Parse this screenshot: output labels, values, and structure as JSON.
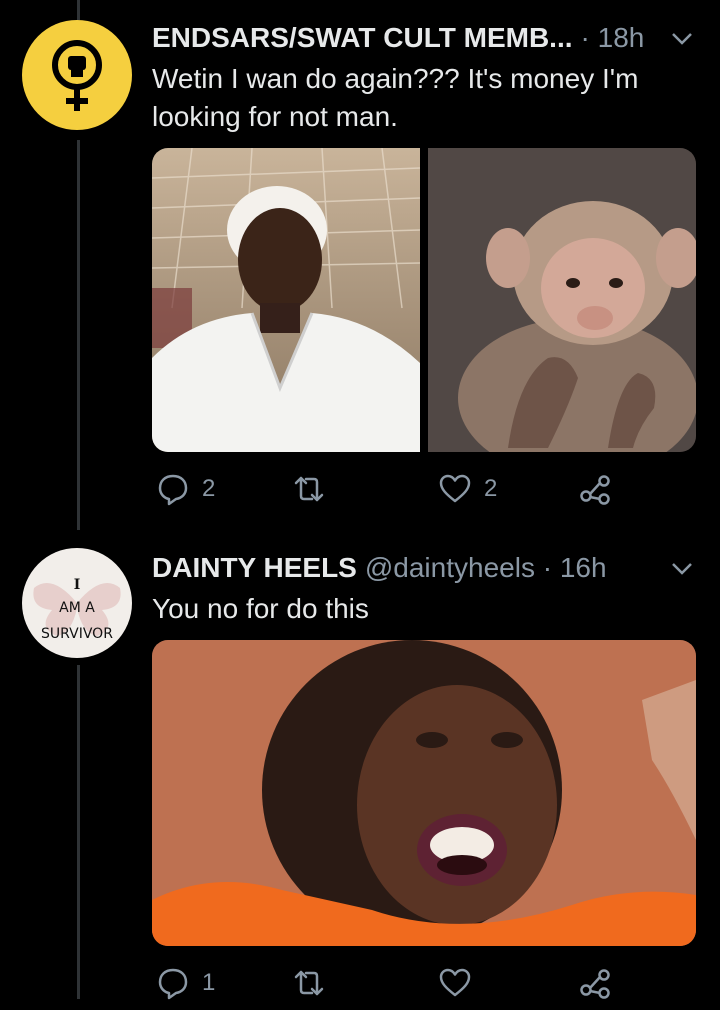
{
  "tweets": [
    {
      "display_name": "ENDSARS/SWAT CULT MEMB...",
      "meta": "· 18h",
      "text": "Wetin I wan do again??? It's money I'm looking for not man.",
      "actions": {
        "replies": "2",
        "retweets": "",
        "likes": "2"
      },
      "avatar_icon": "feminist-fist-icon"
    },
    {
      "display_name": "DAINTY HEELS",
      "meta": "@daintyheels · 16h",
      "text": "You no for do this",
      "avatar_text": {
        "line1": "I",
        "line2": "AM A",
        "line3": "SURVIVOR"
      },
      "actions": {
        "replies": "1",
        "retweets": "",
        "likes": ""
      }
    }
  ],
  "colors": {
    "background": "#000000",
    "text": "#e7e9ea",
    "muted": "#8b98a5",
    "thread_line": "#2f3336",
    "avatar_yellow": "#f5cf3f"
  }
}
